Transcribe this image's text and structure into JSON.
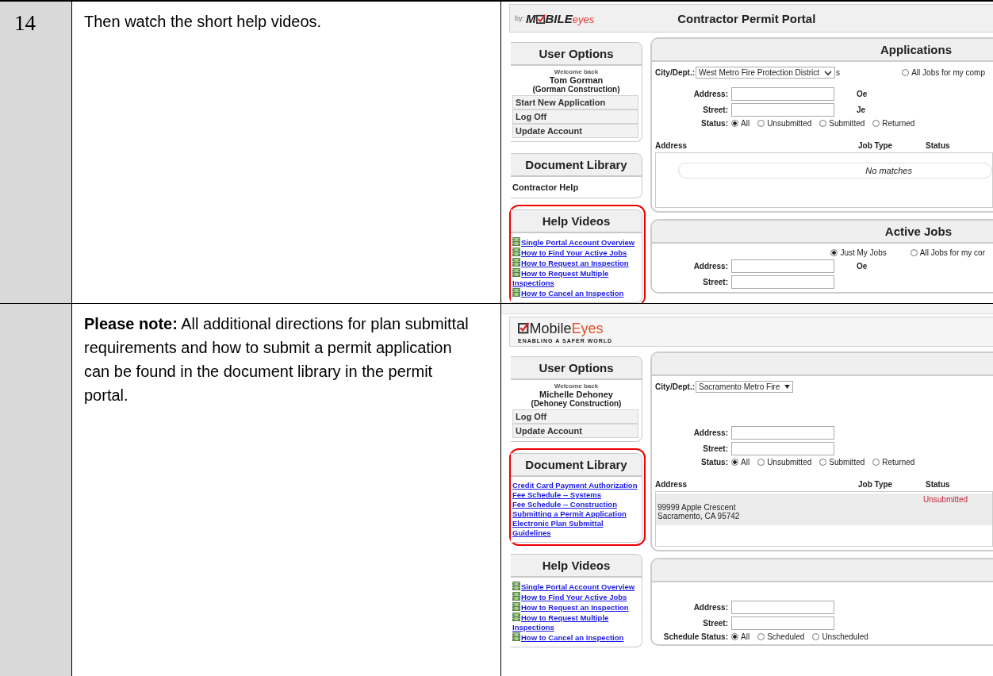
{
  "steps": [
    {
      "number": "14",
      "text": "Then watch the short help videos.",
      "screenshot": {
        "logo": {
          "kind": "byline",
          "prefix": "by:",
          "before": "M",
          "after": "BILE",
          "accent": "eyes"
        },
        "title": "Contractor Permit Portal",
        "sidebar": [
          {
            "title": "User Options",
            "kind": "user",
            "highlighted": false,
            "welcome": "Welcome back",
            "name": "Tom Gorman",
            "company": "(Gorman Construction)",
            "links": [
              {
                "label": "Start New Application",
                "kind": "menu"
              },
              {
                "label": "Log Off",
                "kind": "menu"
              },
              {
                "label": "Update Account",
                "kind": "menu"
              }
            ]
          },
          {
            "title": "Document Library",
            "kind": "links",
            "highlighted": false,
            "links": [
              {
                "label": "Contractor Help",
                "kind": "heading"
              }
            ]
          },
          {
            "title": "Help Videos",
            "kind": "videos",
            "highlighted": true,
            "links": [
              {
                "label": "Single Portal Account Overview",
                "kind": "video"
              },
              {
                "label": "How to Find Your Active Jobs",
                "kind": "video"
              },
              {
                "label": "How to Request an Inspection",
                "kind": "video"
              },
              {
                "label": "How to Request Multiple Inspections",
                "kind": "video"
              },
              {
                "label": "How to Cancel an Inspection",
                "kind": "video"
              }
            ]
          }
        ],
        "main": [
          {
            "title": "Applications",
            "rows": [
              {
                "kind": "select",
                "label": "City/Dept.:",
                "value": "West Metro Fire Protection District",
                "caret": {
                  "kind": "chevron"
                },
                "extras": [
                  {
                    "kind": "text",
                    "label": "s"
                  },
                  {
                    "kind": "radio",
                    "label": "All Jobs for my comp",
                    "selected": false
                  }
                ]
              },
              {
                "kind": "field",
                "label": "Address:",
                "side_label": "Oe"
              },
              {
                "kind": "field",
                "label": "Street:",
                "side_label": "Je"
              },
              {
                "kind": "radios",
                "label": "Status:",
                "options": [
                  {
                    "label": "All",
                    "selected": true
                  },
                  {
                    "label": "Unsubmitted",
                    "selected": false
                  },
                  {
                    "label": "Submitted",
                    "selected": false
                  },
                  {
                    "label": "Returned",
                    "selected": false
                  }
                ]
              },
              {
                "kind": "table",
                "columns": [
                  "Address",
                  "Job Type",
                  "Status"
                ],
                "empty_text": "No matches"
              }
            ]
          },
          {
            "title": "Active Jobs",
            "rows": [
              {
                "kind": "radios",
                "options": [
                  {
                    "label": "Just My Jobs",
                    "selected": true
                  },
                  {
                    "label": "All Jobs for my cor",
                    "selected": false
                  }
                ]
              },
              {
                "kind": "field",
                "label": "Address:",
                "side_label": "Oe"
              },
              {
                "kind": "field",
                "label": "Street:"
              }
            ]
          }
        ]
      }
    },
    {
      "text": "**Please note:** All additional directions for plan submittal requirements and how to submit a permit application can be found in the document library in the permit portal.",
      "screenshot": {
        "bookmarks_bar": true,
        "logo": {
          "kind": "stacked",
          "after": "Mobile",
          "accent": "Eyes",
          "tagline": "ENABLING A SAFER WORLD"
        },
        "sidebar": [
          {
            "title": "User Options",
            "kind": "user",
            "highlighted": false,
            "welcome": "Welcome back",
            "name": "Michelle Dehoney",
            "company": "(Dehoney Construction)",
            "links": [
              {
                "label": "Log Off",
                "kind": "menu"
              },
              {
                "label": "Update Account",
                "kind": "menu"
              }
            ]
          },
          {
            "title": "Document Library",
            "kind": "links",
            "highlighted": true,
            "links": [
              {
                "label": "Credit Card Payment Authorization",
                "kind": "link"
              },
              {
                "label": "Fee Schedule -- Systems",
                "kind": "link"
              },
              {
                "label": "Fee Schedule -- Construction",
                "kind": "link"
              },
              {
                "label": "Submitting a Permit Application",
                "kind": "link"
              },
              {
                "label": "Electronic Plan Submittal Guidelines",
                "kind": "link"
              }
            ]
          },
          {
            "title": "Help Videos",
            "kind": "videos",
            "highlighted": false,
            "links": [
              {
                "label": "Single Portal Account Overview",
                "kind": "video"
              },
              {
                "label": "How to Find Your Active Jobs",
                "kind": "video"
              },
              {
                "label": "How to Request an Inspection",
                "kind": "video"
              },
              {
                "label": "How to Request Multiple Inspections",
                "kind": "video"
              },
              {
                "label": "How to Cancel an Inspection",
                "kind": "video"
              }
            ]
          }
        ],
        "main": [
          {
            "rows": [
              {
                "kind": "select",
                "label": "City/Dept.:",
                "value": "Sacramento Metro Fire",
                "caret": {
                  "kind": "triangle"
                }
              },
              {
                "kind": "spacer"
              },
              {
                "kind": "field",
                "label": "Address:"
              },
              {
                "kind": "field",
                "label": "Street:"
              },
              {
                "kind": "radios",
                "label": "Status:",
                "options": [
                  {
                    "label": "All",
                    "selected": true
                  },
                  {
                    "label": "Unsubmitted",
                    "selected": false
                  },
                  {
                    "label": "Submitted",
                    "selected": false
                  },
                  {
                    "label": "Returned",
                    "selected": false
                  }
                ]
              },
              {
                "kind": "table",
                "columns": [
                  "Address",
                  "Job Type",
                  "Status"
                ],
                "rows": [
                  {
                    "address": [
                      "99999 Apple Crescent",
                      "Sacramento, CA 95742"
                    ],
                    "status": "Unsubmitted"
                  }
                ]
              }
            ]
          },
          {
            "rows": [
              {
                "kind": "spacer"
              },
              {
                "kind": "field",
                "label": "Address:"
              },
              {
                "kind": "field",
                "label": "Street:"
              },
              {
                "kind": "radios",
                "label": "Schedule Status:",
                "options": [
                  {
                    "label": "All",
                    "selected": true
                  },
                  {
                    "label": "Scheduled",
                    "selected": false
                  },
                  {
                    "label": "Unscheduled",
                    "selected": false
                  }
                ]
              }
            ]
          }
        ]
      }
    }
  ]
}
